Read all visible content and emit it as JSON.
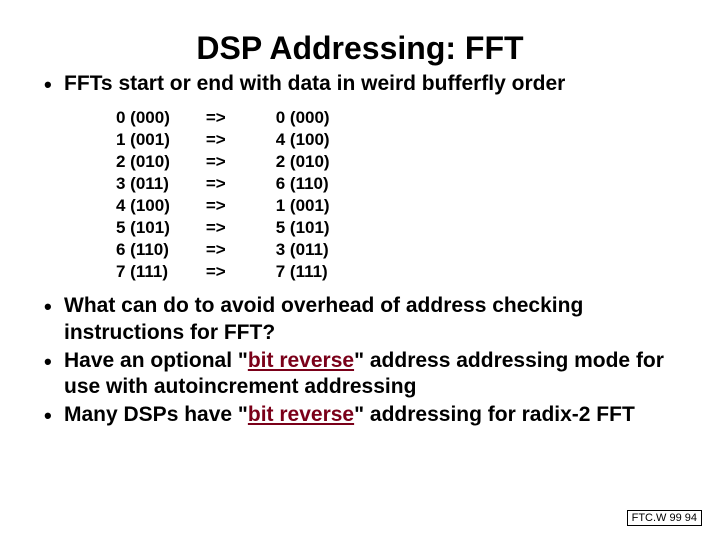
{
  "title": "DSP Addressing: FFT",
  "bullet1": "FFTs start or end with data in weird bufferfly order",
  "rows": [
    {
      "l": "0 (000)",
      "m": "=>",
      "r": "0 (000)"
    },
    {
      "l": "1 (001)",
      "m": "=>",
      "r": "4 (100)"
    },
    {
      "l": "2 (010)",
      "m": "=>",
      "r": "2 (010)"
    },
    {
      "l": "3 (011)",
      "m": "=>",
      "r": "6 (110)"
    },
    {
      "l": "4 (100)",
      "m": "=>",
      "r": "1 (001)"
    },
    {
      "l": "5 (101)",
      "m": "=>",
      "r": "5 (101)"
    },
    {
      "l": "6 (110)",
      "m": "=>",
      "r": "3 (011)"
    },
    {
      "l": "7 (111)",
      "m": "=>",
      "r": "7 (111)"
    }
  ],
  "bullet2": "What can do to avoid overhead of address checking instructions for FFT?",
  "bullet3_a": "Have an optional \"",
  "bullet3_b": "bit reverse",
  "bullet3_c": "\" address addressing mode for use with autoincrement addressing",
  "bullet4_a": "Many DSPs have \"",
  "bullet4_b": "bit reverse",
  "bullet4_c": "\" addressing for radix-2 FFT",
  "footer": "FTC.W 99 94"
}
